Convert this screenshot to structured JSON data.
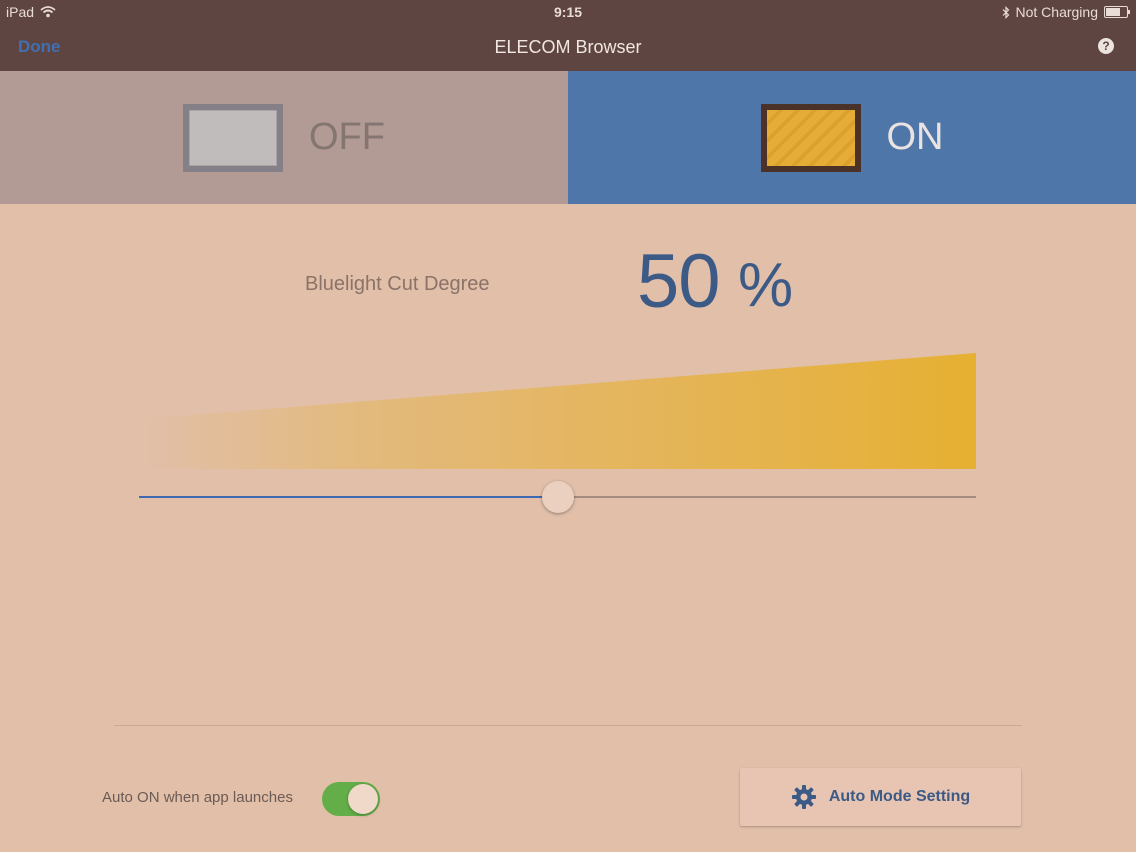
{
  "status_bar": {
    "device": "iPad",
    "time": "9:15",
    "charging": "Not Charging"
  },
  "nav": {
    "done_label": "Done",
    "title": "ELECOM Browser",
    "help_glyph": "?"
  },
  "toggle": {
    "off_label": "OFF",
    "on_label": "ON",
    "selected": "ON"
  },
  "degree": {
    "label": "Bluelight Cut Degree",
    "value": "50",
    "unit": "%"
  },
  "slider": {
    "value_percent": 50
  },
  "auto_on": {
    "label": "Auto ON when app launches",
    "enabled": true
  },
  "auto_mode": {
    "label": "Auto Mode Setting"
  },
  "icons": {
    "wifi": "wifi-icon",
    "bluetooth": "bluetooth-icon",
    "battery": "battery-icon",
    "help": "help-icon",
    "gear": "gear-icon"
  },
  "colors": {
    "accent_blue": "#4f76a8",
    "text_blue": "#3c5a86",
    "switch_green": "#63ae48",
    "wedge_yellow": "#e6b032"
  }
}
